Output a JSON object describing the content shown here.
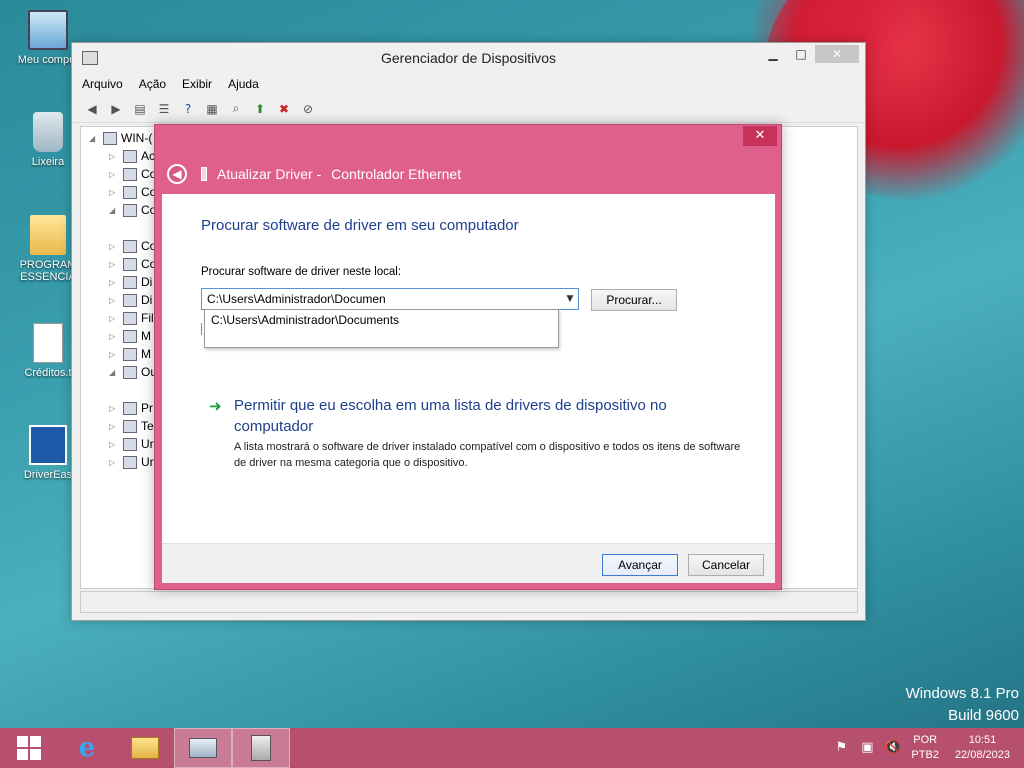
{
  "desktop": {
    "icons": [
      {
        "label": "Meu comput"
      },
      {
        "label": "Lixeira"
      },
      {
        "label": "PROGRAM ESSENCIA"
      },
      {
        "label": "Créditos.t"
      },
      {
        "label": "DriverEas"
      }
    ],
    "watermark_line1": "Windows 8.1 Pro",
    "watermark_line2": "Build 9600"
  },
  "device_manager": {
    "title": "Gerenciador de Dispositivos",
    "menu": [
      "Arquivo",
      "Ação",
      "Exibir",
      "Ajuda"
    ],
    "tree": [
      {
        "label": "WIN-("
      },
      {
        "label": "Ac"
      },
      {
        "label": "Co"
      },
      {
        "label": "Co"
      },
      {
        "label": "Co"
      },
      {
        "label": "Co"
      },
      {
        "label": "Co"
      },
      {
        "label": "Di"
      },
      {
        "label": "Di"
      },
      {
        "label": "Fil"
      },
      {
        "label": "M"
      },
      {
        "label": "M"
      },
      {
        "label": "Ou"
      },
      {
        "label": "Pr"
      },
      {
        "label": "Te"
      },
      {
        "label": "Ur"
      },
      {
        "label": "Ur"
      }
    ]
  },
  "dialog": {
    "close_glyph": "✕",
    "title_prefix": "Atualizar Driver -",
    "title_device": "Controlador Ethernet",
    "heading": "Procurar software de driver em seu computador",
    "field_label": "Procurar software de driver neste local:",
    "path_value": "C:\\Users\\Administrador\\Documen",
    "autocomplete_item": "C:\\Users\\Administrador\\Documents",
    "browse_label": "Procurar...",
    "option_title": "Permitir que eu escolha em uma lista de drivers de dispositivo no computador",
    "option_desc": "A lista mostrará o software de driver instalado compatível com o dispositivo e todos os itens de software de driver na mesma categoria que o dispositivo.",
    "next_label": "Avançar",
    "cancel_label": "Cancelar"
  },
  "taskbar": {
    "lang_line1": "POR",
    "lang_line2": "PTB2",
    "time": "10:51",
    "date": "22/08/2023"
  },
  "colors": {
    "dialog_frame": "#e0608c",
    "taskbar": "#b7506f",
    "link_blue": "#1e3f8a"
  }
}
